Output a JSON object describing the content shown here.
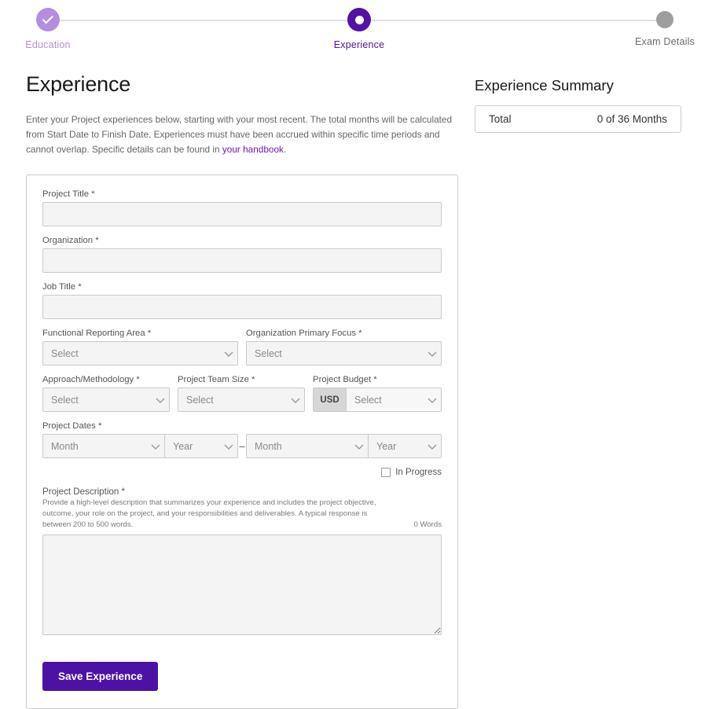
{
  "stepper": {
    "steps": [
      {
        "label": "Education",
        "state": "done"
      },
      {
        "label": "Experience",
        "state": "current"
      },
      {
        "label": "Exam Details",
        "state": "upcoming"
      }
    ]
  },
  "page": {
    "title": "Experience",
    "intro_part1": "Enter your Project experiences below, starting with your most recent. The total months will be calculated from Start Date to Finish Date. Experiences must have been accrued within specific time periods and cannot overlap. Specific details can be found in ",
    "intro_link": "your handbook",
    "intro_part2": "."
  },
  "summary": {
    "title": "Experience Summary",
    "total_label": "Total",
    "total_value": "0 of 36 Months"
  },
  "form": {
    "project_title": {
      "label": "Project Title *",
      "value": "",
      "placeholder": ""
    },
    "organization": {
      "label": "Organization *",
      "value": "",
      "placeholder": ""
    },
    "job_title": {
      "label": "Job Title *",
      "value": "",
      "placeholder": ""
    },
    "functional_reporting_area": {
      "label": "Functional Reporting Area *",
      "selected": "Select"
    },
    "organization_primary_focus": {
      "label": "Organization Primary Focus *",
      "selected": "Select"
    },
    "approach_methodology": {
      "label": "Approach/Methodology *",
      "selected": "Select"
    },
    "project_team_size": {
      "label": "Project Team Size *",
      "selected": "Select"
    },
    "project_budget": {
      "label": "Project Budget *",
      "currency": "USD",
      "selected": "Select"
    },
    "project_dates": {
      "label": "Project Dates *",
      "start_month": "Month",
      "start_year": "Year",
      "separator": "–",
      "end_month": "Month",
      "end_year": "Year"
    },
    "in_progress": {
      "label": "In Progress",
      "checked": false
    },
    "project_description": {
      "label": "Project Description *",
      "hint": "Provide a high-level description that summarizes your experience and includes the project objective, outcome, your role on the project, and your responsibilities and deliverables. A typical response is between 200 to 500 words.",
      "word_count": "0 Words",
      "value": ""
    },
    "save_button": "Save Experience"
  },
  "colors": {
    "accent_purple": "#4c12a3",
    "step_done_purple": "#b38ede",
    "step_current_purple": "#5112a5",
    "step_upcoming_gray": "#9e9e9e",
    "link_purple": "#6a1bb0",
    "input_bg": "#f4f4f4",
    "border_gray": "#c9c9c9"
  }
}
